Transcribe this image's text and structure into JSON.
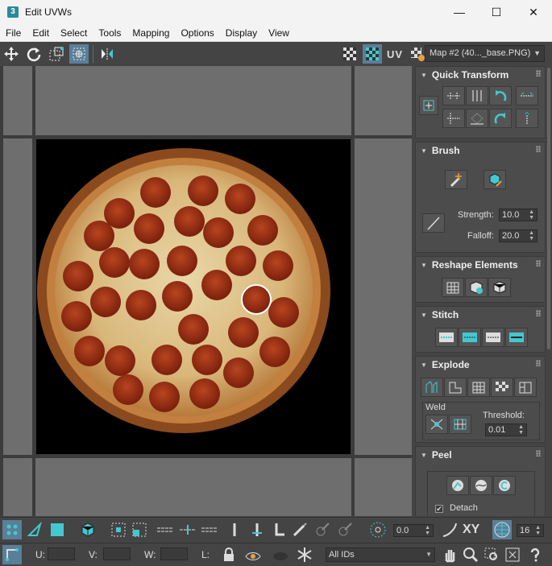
{
  "window": {
    "title": "Edit UVWs",
    "app_icon": "3",
    "minimize": "—",
    "maximize": "☐",
    "close": "✕"
  },
  "menu": [
    "File",
    "Edit",
    "Select",
    "Tools",
    "Mapping",
    "Options",
    "Display",
    "View"
  ],
  "toolbar": {
    "uv_label": "UV",
    "map_select": "Map #2 (40..._base.PNG)"
  },
  "rollouts": {
    "quick_transform": {
      "title": "Quick Transform"
    },
    "brush": {
      "title": "Brush",
      "strength_label": "Strength:",
      "strength_value": "10.0",
      "falloff_label": "Falloff:",
      "falloff_value": "20.0"
    },
    "reshape": {
      "title": "Reshape Elements"
    },
    "stitch": {
      "title": "Stitch"
    },
    "explode": {
      "title": "Explode",
      "weld_label": "Weld",
      "threshold_label": "Threshold:",
      "threshold_value": "0.01"
    },
    "peel": {
      "title": "Peel",
      "detach_label": "Detach",
      "detach_checked": true
    }
  },
  "bottom": {
    "angle_value": "0.0",
    "xy_label": "XY",
    "snap_value": "16",
    "u_label": "U:",
    "v_label": "V:",
    "w_label": "W:",
    "l_label": "L:",
    "ids_select": "All IDs"
  },
  "colors": {
    "accent": "#44c8d0",
    "panel": "#444444",
    "viewport": "#6e6e6e"
  }
}
